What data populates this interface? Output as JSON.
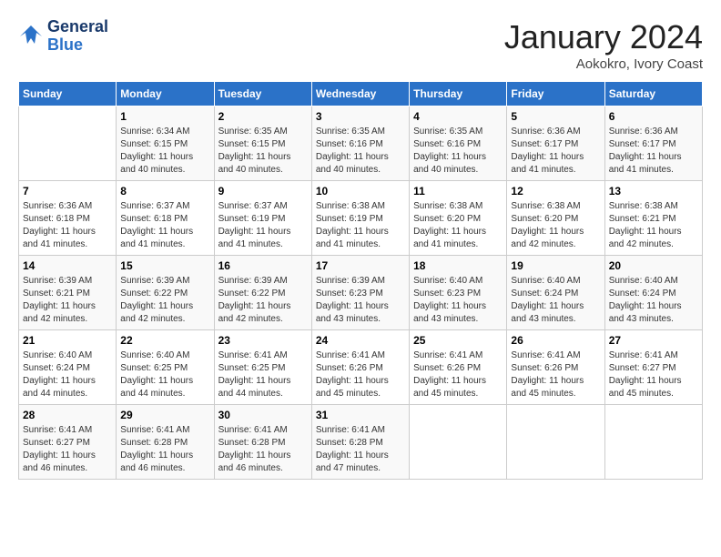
{
  "header": {
    "logo_line1": "General",
    "logo_line2": "Blue",
    "month_title": "January 2024",
    "location": "Aokokro, Ivory Coast"
  },
  "weekdays": [
    "Sunday",
    "Monday",
    "Tuesday",
    "Wednesday",
    "Thursday",
    "Friday",
    "Saturday"
  ],
  "weeks": [
    [
      {
        "day": "",
        "detail": ""
      },
      {
        "day": "1",
        "detail": "Sunrise: 6:34 AM\nSunset: 6:15 PM\nDaylight: 11 hours\nand 40 minutes."
      },
      {
        "day": "2",
        "detail": "Sunrise: 6:35 AM\nSunset: 6:15 PM\nDaylight: 11 hours\nand 40 minutes."
      },
      {
        "day": "3",
        "detail": "Sunrise: 6:35 AM\nSunset: 6:16 PM\nDaylight: 11 hours\nand 40 minutes."
      },
      {
        "day": "4",
        "detail": "Sunrise: 6:35 AM\nSunset: 6:16 PM\nDaylight: 11 hours\nand 40 minutes."
      },
      {
        "day": "5",
        "detail": "Sunrise: 6:36 AM\nSunset: 6:17 PM\nDaylight: 11 hours\nand 41 minutes."
      },
      {
        "day": "6",
        "detail": "Sunrise: 6:36 AM\nSunset: 6:17 PM\nDaylight: 11 hours\nand 41 minutes."
      }
    ],
    [
      {
        "day": "7",
        "detail": "Sunrise: 6:36 AM\nSunset: 6:18 PM\nDaylight: 11 hours\nand 41 minutes."
      },
      {
        "day": "8",
        "detail": "Sunrise: 6:37 AM\nSunset: 6:18 PM\nDaylight: 11 hours\nand 41 minutes."
      },
      {
        "day": "9",
        "detail": "Sunrise: 6:37 AM\nSunset: 6:19 PM\nDaylight: 11 hours\nand 41 minutes."
      },
      {
        "day": "10",
        "detail": "Sunrise: 6:38 AM\nSunset: 6:19 PM\nDaylight: 11 hours\nand 41 minutes."
      },
      {
        "day": "11",
        "detail": "Sunrise: 6:38 AM\nSunset: 6:20 PM\nDaylight: 11 hours\nand 41 minutes."
      },
      {
        "day": "12",
        "detail": "Sunrise: 6:38 AM\nSunset: 6:20 PM\nDaylight: 11 hours\nand 42 minutes."
      },
      {
        "day": "13",
        "detail": "Sunrise: 6:38 AM\nSunset: 6:21 PM\nDaylight: 11 hours\nand 42 minutes."
      }
    ],
    [
      {
        "day": "14",
        "detail": "Sunrise: 6:39 AM\nSunset: 6:21 PM\nDaylight: 11 hours\nand 42 minutes."
      },
      {
        "day": "15",
        "detail": "Sunrise: 6:39 AM\nSunset: 6:22 PM\nDaylight: 11 hours\nand 42 minutes."
      },
      {
        "day": "16",
        "detail": "Sunrise: 6:39 AM\nSunset: 6:22 PM\nDaylight: 11 hours\nand 42 minutes."
      },
      {
        "day": "17",
        "detail": "Sunrise: 6:39 AM\nSunset: 6:23 PM\nDaylight: 11 hours\nand 43 minutes."
      },
      {
        "day": "18",
        "detail": "Sunrise: 6:40 AM\nSunset: 6:23 PM\nDaylight: 11 hours\nand 43 minutes."
      },
      {
        "day": "19",
        "detail": "Sunrise: 6:40 AM\nSunset: 6:24 PM\nDaylight: 11 hours\nand 43 minutes."
      },
      {
        "day": "20",
        "detail": "Sunrise: 6:40 AM\nSunset: 6:24 PM\nDaylight: 11 hours\nand 43 minutes."
      }
    ],
    [
      {
        "day": "21",
        "detail": "Sunrise: 6:40 AM\nSunset: 6:24 PM\nDaylight: 11 hours\nand 44 minutes."
      },
      {
        "day": "22",
        "detail": "Sunrise: 6:40 AM\nSunset: 6:25 PM\nDaylight: 11 hours\nand 44 minutes."
      },
      {
        "day": "23",
        "detail": "Sunrise: 6:41 AM\nSunset: 6:25 PM\nDaylight: 11 hours\nand 44 minutes."
      },
      {
        "day": "24",
        "detail": "Sunrise: 6:41 AM\nSunset: 6:26 PM\nDaylight: 11 hours\nand 45 minutes."
      },
      {
        "day": "25",
        "detail": "Sunrise: 6:41 AM\nSunset: 6:26 PM\nDaylight: 11 hours\nand 45 minutes."
      },
      {
        "day": "26",
        "detail": "Sunrise: 6:41 AM\nSunset: 6:26 PM\nDaylight: 11 hours\nand 45 minutes."
      },
      {
        "day": "27",
        "detail": "Sunrise: 6:41 AM\nSunset: 6:27 PM\nDaylight: 11 hours\nand 45 minutes."
      }
    ],
    [
      {
        "day": "28",
        "detail": "Sunrise: 6:41 AM\nSunset: 6:27 PM\nDaylight: 11 hours\nand 46 minutes."
      },
      {
        "day": "29",
        "detail": "Sunrise: 6:41 AM\nSunset: 6:28 PM\nDaylight: 11 hours\nand 46 minutes."
      },
      {
        "day": "30",
        "detail": "Sunrise: 6:41 AM\nSunset: 6:28 PM\nDaylight: 11 hours\nand 46 minutes."
      },
      {
        "day": "31",
        "detail": "Sunrise: 6:41 AM\nSunset: 6:28 PM\nDaylight: 11 hours\nand 47 minutes."
      },
      {
        "day": "",
        "detail": ""
      },
      {
        "day": "",
        "detail": ""
      },
      {
        "day": "",
        "detail": ""
      }
    ]
  ]
}
